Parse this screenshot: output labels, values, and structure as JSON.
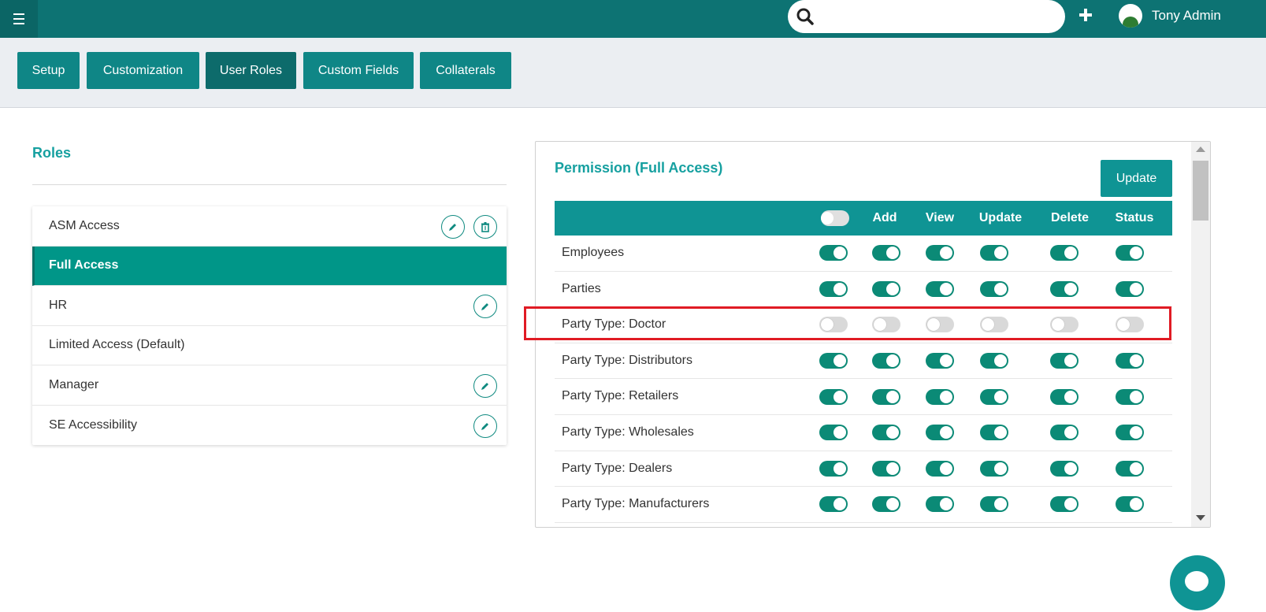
{
  "topbar": {
    "user_name": "Tony Admin",
    "search_placeholder": "",
    "add_icon": "plus-icon",
    "menu_icon": "hamburger-icon",
    "search_icon": "search-icon"
  },
  "nav_tabs": [
    {
      "label": "Setup",
      "active": false
    },
    {
      "label": "Customization",
      "active": false
    },
    {
      "label": "User Roles",
      "active": true
    },
    {
      "label": "Custom Fields",
      "active": false
    },
    {
      "label": "Collaterals",
      "active": false
    }
  ],
  "roles": {
    "title": "Roles",
    "items": [
      {
        "label": "ASM Access",
        "selected": false,
        "edit": true,
        "delete": true
      },
      {
        "label": "Full Access",
        "selected": true,
        "edit": false,
        "delete": false
      },
      {
        "label": "HR",
        "selected": false,
        "edit": true,
        "delete": false
      },
      {
        "label": "Limited Access (Default)",
        "selected": false,
        "edit": false,
        "delete": false
      },
      {
        "label": "Manager",
        "selected": false,
        "edit": true,
        "delete": false
      },
      {
        "label": "SE Accessibility",
        "selected": false,
        "edit": true,
        "delete": false
      }
    ]
  },
  "permissions": {
    "title": "Permission (Full Access)",
    "update_label": "Update",
    "columns": [
      "Add",
      "View",
      "Update",
      "Delete",
      "Status"
    ],
    "master_toggle": false,
    "rows": [
      {
        "label": "Employees",
        "values": [
          true,
          true,
          true,
          true,
          true,
          true
        ]
      },
      {
        "label": "Parties",
        "values": [
          true,
          true,
          true,
          true,
          true,
          true
        ]
      },
      {
        "label": "Party Type: Doctor",
        "values": [
          false,
          false,
          false,
          false,
          false,
          false
        ]
      },
      {
        "label": "Party Type: Distributors",
        "values": [
          true,
          true,
          true,
          true,
          true,
          true
        ]
      },
      {
        "label": "Party Type: Retailers",
        "values": [
          true,
          true,
          true,
          true,
          true,
          true
        ]
      },
      {
        "label": "Party Type: Wholesales",
        "values": [
          true,
          true,
          true,
          true,
          true,
          true
        ]
      },
      {
        "label": "Party Type: Dealers",
        "values": [
          true,
          true,
          true,
          true,
          true,
          true
        ]
      },
      {
        "label": "Party Type: Manufacturers",
        "values": [
          true,
          true,
          true,
          true,
          true,
          true
        ]
      }
    ]
  },
  "colors": {
    "topbar": "#0d7373",
    "accent": "#0f9494",
    "toggle_on": "#0b8a76",
    "highlight": "#e01b24"
  }
}
